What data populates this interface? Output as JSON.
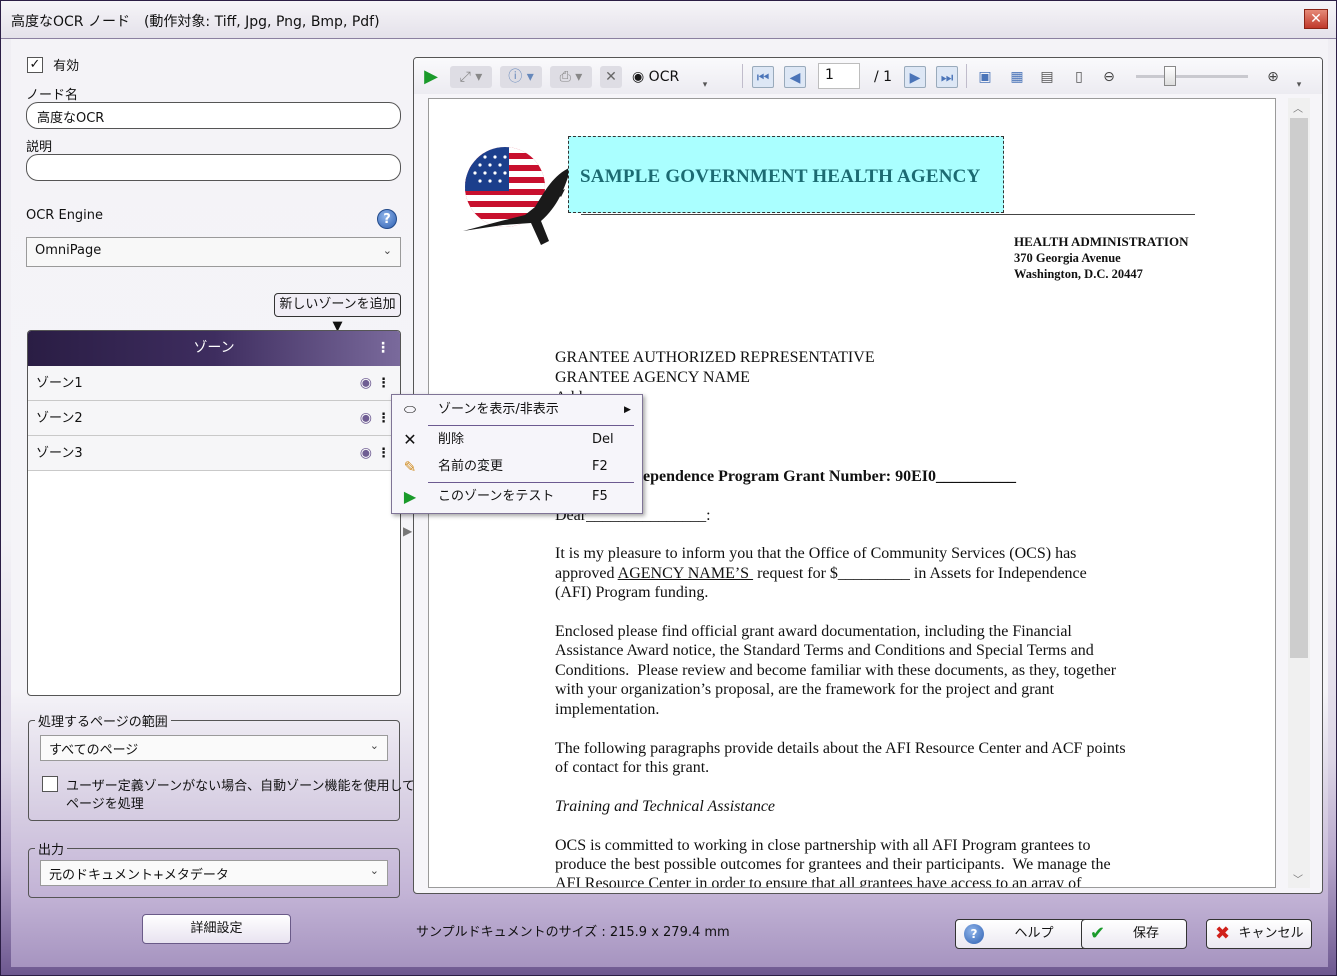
{
  "window": {
    "title": "高度なOCR ノード　(動作対象: Tiff, Jpg, Png, Bmp, Pdf)",
    "close_glyph": "✕"
  },
  "left": {
    "enabled_label": "有効",
    "enabled_checked": true,
    "node_name_label": "ノード名",
    "node_name_value": "高度なOCR",
    "description_label": "説明",
    "description_value": "",
    "ocr_engine_label": "OCR Engine",
    "ocr_engine_value": "OmniPage",
    "add_zone_label": "新しいゾーンを追加 ▼",
    "zones_header": "ゾーン",
    "zones": [
      {
        "label": "ゾーン1"
      },
      {
        "label": "ゾーン2"
      },
      {
        "label": "ゾーン3"
      }
    ],
    "page_range_legend": "処理するページの範囲",
    "page_range_value": "すべてのページ",
    "auto_zone_label_line1": "ユーザー定義ゾーンがない場合、自動ゾーン機能を使用して",
    "auto_zone_label_line2": "ページを処理",
    "output_legend": "出力",
    "output_value": "元のドキュメント+メタデータ",
    "advanced_button": "詳細設定"
  },
  "toolbar": {
    "ocr_label": "OCR",
    "page_current": "1",
    "page_total": "/ 1",
    "zoom_fraction": 0.3
  },
  "document": {
    "agency_title": "SAMPLE GOVERNMENT HEALTH AGENCY",
    "address_line1": "HEALTH ADMINISTRATION",
    "address_line2": "370 Georgia Avenue",
    "address_line3": "Washington, D.C. 20447",
    "recipient_line1": "GRANTEE AUTHORIZED REPRESENTATIVE",
    "recipient_line2": "GRANTEE AGENCY NAME",
    "recipient_line3": "Address",
    "grant_line": "Independence Program Grant Number:  90EI0__________",
    "dear_line": "Dear_______________:",
    "para1_line1": "It is my pleasure to inform you that the Office of Community Services (OCS) has",
    "para1_line2a": "approved ",
    "para1_line2b": "AGENCY NAME’S ",
    "para1_line2c": " request for $_________ in Assets for Independence",
    "para1_line3": "(AFI) Program funding.",
    "para2_line1": "Enclosed please find official grant award documentation, including the Financial",
    "para2_line2": "Assistance Award notice, the Standard Terms and Conditions and Special Terms and",
    "para2_line3": "Conditions.  Please review and become familiar with these documents, as they, together",
    "para2_line4": "with your organization’s proposal, are the framework for the project and grant",
    "para2_line5": "implementation.",
    "para3_line1": "The following paragraphs provide details about the AFI Resource Center and ACF points",
    "para3_line2": "of contact for this grant.",
    "section_heading": "Training and Technical Assistance",
    "para4_line1": "OCS is committed to working in close partnership with all AFI Program grantees to",
    "para4_line2": "produce the best possible outcomes for grantees and their participants.  We manage the",
    "para4_line3": "AFI Resource Center in order to ensure that all grantees have access to an array of"
  },
  "context_menu": {
    "items": [
      {
        "label": "ゾーンを表示/非表示",
        "shortcut": "",
        "icon": "ellipse-icon"
      },
      {
        "label": "削除",
        "shortcut": "Del",
        "icon": "x-icon"
      },
      {
        "label": "名前の変更",
        "shortcut": "F2",
        "icon": "pencil-icon"
      },
      {
        "label": "このゾーンをテスト",
        "shortcut": "F5",
        "icon": "play-icon"
      }
    ]
  },
  "footer": {
    "sample_size": "サンプルドキュメントのサイズ : 215.9 x 279.4 mm",
    "help_label": "ヘルプ",
    "save_label": "保存",
    "cancel_label": "キャンセル"
  },
  "colors": {
    "zone_highlight": "#aaffff",
    "accent_purple": "#3e2d5f",
    "play_green": "#1a9a2a",
    "cancel_red": "#d0201a"
  }
}
